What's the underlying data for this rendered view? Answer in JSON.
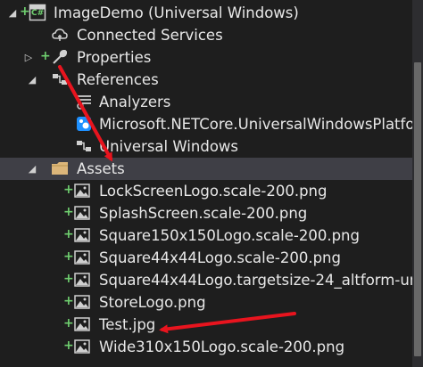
{
  "tree": {
    "project": {
      "label": "ImageDemo (Universal Windows)",
      "badge": "C#"
    },
    "connected_services": {
      "label": "Connected Services"
    },
    "properties": {
      "label": "Properties"
    },
    "references": {
      "label": "References"
    },
    "analyzers": {
      "label": "Analyzers"
    },
    "netcore": {
      "label": "Microsoft.NETCore.UniversalWindowsPlatfo"
    },
    "universal_windows": {
      "label": "Universal Windows"
    },
    "assets": {
      "label": "Assets"
    },
    "asset_files": [
      {
        "label": "LockScreenLogo.scale-200.png"
      },
      {
        "label": "SplashScreen.scale-200.png"
      },
      {
        "label": "Square150x150Logo.scale-200.png"
      },
      {
        "label": "Square44x44Logo.scale-200.png"
      },
      {
        "label": "Square44x44Logo.targetsize-24_altform-un"
      },
      {
        "label": "StoreLogo.png"
      },
      {
        "label": "Test.jpg"
      },
      {
        "label": "Wide310x150Logo.scale-200.png"
      }
    ]
  },
  "colors": {
    "background": "#1e1e1e",
    "selected_row": "#3f3f46",
    "added_marker": "#6fcf6f",
    "annotation_arrow": "#e8141e",
    "folder": "#dcb67a"
  }
}
